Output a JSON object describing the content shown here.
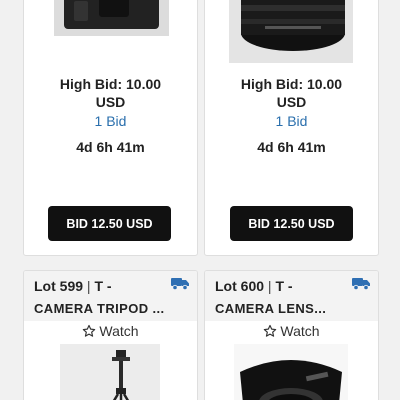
{
  "top_cards": [
    {
      "high_bid": "High Bid: 10.00",
      "currency": "USD",
      "bid_count": "1 Bid",
      "time_left": "4d 6h 41m",
      "bid_button": "BID 12.50 USD",
      "photo_icon": "camera-body-image"
    },
    {
      "high_bid": "High Bid: 10.00",
      "currency": "USD",
      "bid_count": "1 Bid",
      "time_left": "4d 6h 41m",
      "bid_button": "BID 12.50 USD",
      "photo_icon": "camera-lens-image"
    }
  ],
  "bottom_cards": [
    {
      "lot": "Lot 599",
      "separator": "|",
      "category": "T -",
      "title": "CAMERA TRIPOD ...",
      "watch": "Watch",
      "shipping_icon": "truck-icon",
      "photo_icon": "tripod-image"
    },
    {
      "lot": "Lot 600",
      "separator": "|",
      "category": "T -",
      "title": "CAMERA LENS...",
      "watch": "Watch",
      "shipping_icon": "truck-icon",
      "photo_icon": "lens-hood-image"
    }
  ],
  "colors": {
    "bid_count_link": "#2a6fad",
    "shipping_icon": "#2f6fb3",
    "bid_button_bg": "#111111"
  }
}
